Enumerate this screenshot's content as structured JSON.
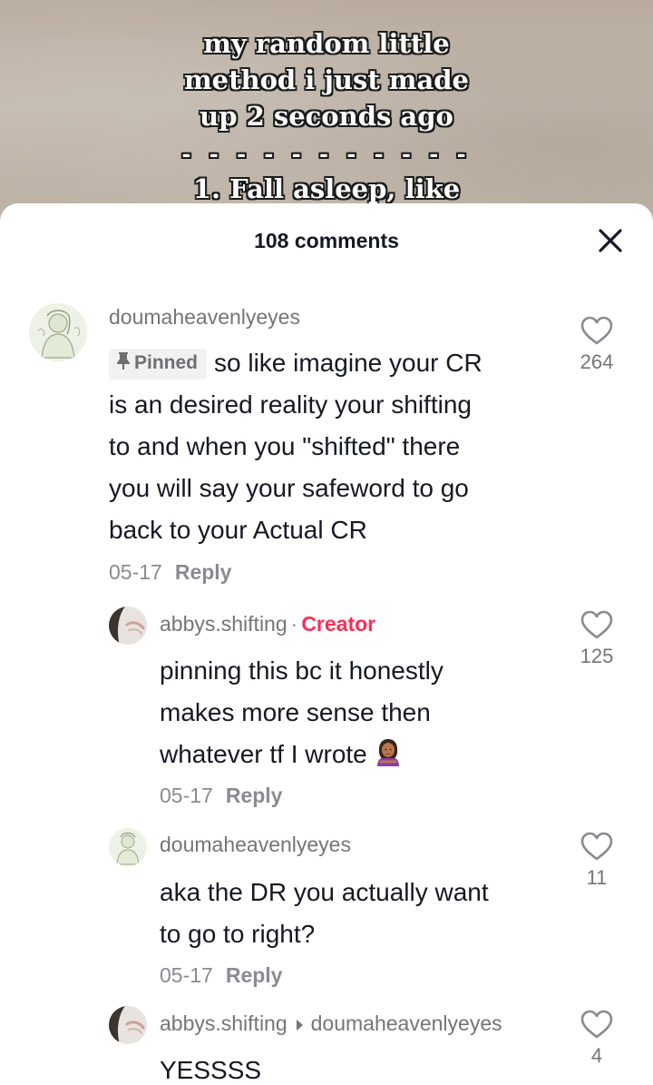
{
  "video": {
    "caption_lines": [
      "my random little",
      "method i just made",
      "up 2 seconds ago",
      "- - - - - - - - - - -",
      "1. Fall asleep, like"
    ]
  },
  "sheet": {
    "comment_count": "108 comments"
  },
  "comments": [
    {
      "username": "doumaheavenlyeyes",
      "pinned_label": "Pinned",
      "text_lines": [
        "so like imagine your CR",
        "is an desired reality your shifting",
        "to and when you \"shifted\" there",
        "you will say your safeword to go",
        "back to your Actual CR"
      ],
      "date": "05-17",
      "reply_label": "Reply",
      "likes": "264"
    },
    {
      "username": "abbys.shifting",
      "separator": "·",
      "creator_label": "Creator",
      "text_lines": [
        "pinning this bc it honestly",
        "makes more sense then",
        "whatever tf I wrote"
      ],
      "emoji": "person-gesturing-no",
      "date": "05-17",
      "reply_label": "Reply",
      "likes": "125"
    },
    {
      "username": "doumaheavenlyeyes",
      "text_lines": [
        "aka the DR you actually want",
        "to go to right?"
      ],
      "date": "05-17",
      "reply_label": "Reply",
      "likes": "11"
    },
    {
      "username": "abbys.shifting",
      "reply_to": "doumaheavenlyeyes",
      "text_lines": [
        "YESSSS"
      ],
      "likes": "4"
    }
  ],
  "colors": {
    "creator": "#fe2c55",
    "text": "#161823",
    "muted": "#8a8b91"
  }
}
